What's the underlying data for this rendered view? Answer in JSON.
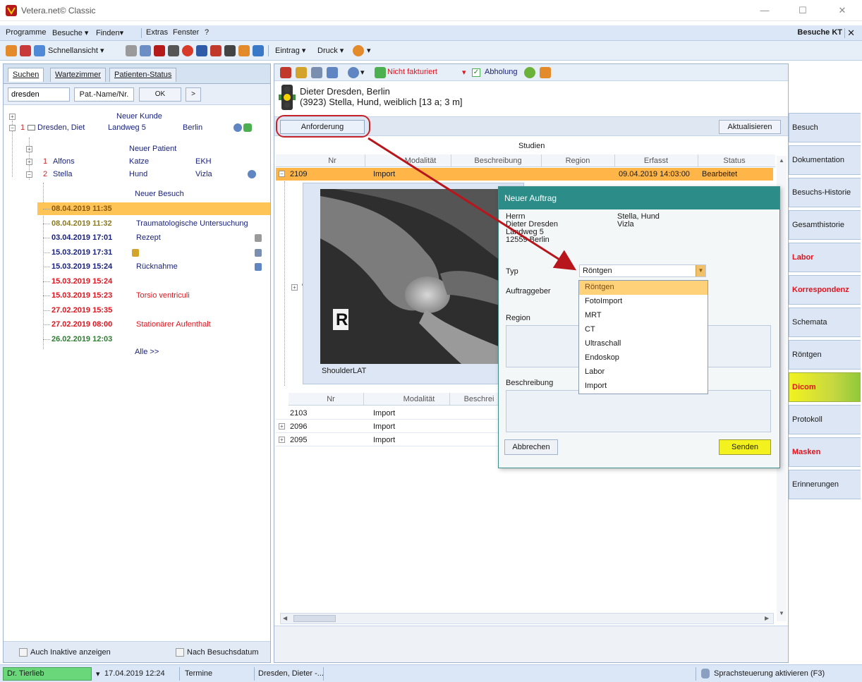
{
  "window": {
    "title": "Vetera.net© Classic"
  },
  "menu": {
    "items": [
      "Programme",
      "Besuche ▾",
      "Finden▾",
      "Extras",
      "Fenster",
      "?"
    ],
    "context_title": "Besuche KT",
    "close": "✕"
  },
  "toolbar1": {
    "schnellansicht": "Schnellansicht ▾",
    "eintrag": "Eintrag ▾",
    "druck": "Druck ▾"
  },
  "left": {
    "tabs": [
      "Suchen",
      "Wartezimmer",
      "Patienten-Status"
    ],
    "search_value": "dresden",
    "patname_label": "Pat.-Name/Nr.",
    "ok_label": "OK",
    "next_label": ">",
    "neuer_kunde": "Neuer Kunde",
    "customer": {
      "num": "1",
      "name": "Dresden, Diet",
      "street": "Landweg 5",
      "city": "Berlin"
    },
    "neuer_patient": "Neuer Patient",
    "patients": [
      {
        "num": "1",
        "name": "Alfons",
        "species": "Katze",
        "breed": "EKH"
      },
      {
        "num": "2",
        "name": "Stella",
        "species": "Hund",
        "breed": "Vizla"
      }
    ],
    "neuer_besuch": "Neuer Besuch",
    "visits": [
      {
        "date": "08.04.2019 11:35",
        "desc": "",
        "color": "#8a5a10"
      },
      {
        "date": "08.04.2019 11:32",
        "desc": "Traumatologische Untersuchung",
        "color": "#8a7a20"
      },
      {
        "date": "03.04.2019 17:01",
        "desc": "Rezept",
        "color": "#1a237e"
      },
      {
        "date": "15.03.2019 17:31",
        "desc": "",
        "color": "#1a237e"
      },
      {
        "date": "15.03.2019 15:24",
        "desc": "Rücknahme",
        "color": "#1a237e"
      },
      {
        "date": "15.03.2019 15:24",
        "desc": "",
        "color": "#e0141e"
      },
      {
        "date": "15.03.2019 15:23",
        "desc": "Torsio ventriculi",
        "color": "#e0141e"
      },
      {
        "date": "27.02.2019 15:35",
        "desc": "",
        "color": "#e0141e"
      },
      {
        "date": "27.02.2019 08:00",
        "desc": "Stationärer Aufenthalt",
        "color": "#e0141e"
      },
      {
        "date": "26.02.2019 12:03",
        "desc": "",
        "color": "#2e7d32"
      }
    ],
    "alle": "Alle >>",
    "auch_inaktive": "Auch Inaktive anzeigen",
    "nach_besuchsdatum": "Nach Besuchsdatum"
  },
  "toolbar2": {
    "nicht_fakturiert": "Nicht fakturiert",
    "abholung": "Abholung"
  },
  "patient": {
    "line1": "Dieter Dresden, Berlin",
    "line2": "(3923) Stella, Hund, weiblich [13 a; 3 m]"
  },
  "studies": {
    "anforderung": "Anforderung",
    "aktualisieren": "Aktualisieren",
    "title": "Studien",
    "columns": [
      "Nr",
      "Modalität",
      "Beschreibung",
      "Region",
      "Erfasst",
      "Status"
    ],
    "selected": {
      "nr": "2109",
      "modalitaet": "Import",
      "erfasst": "09.04.2019 14:03:00",
      "status": "Bearbeitet"
    },
    "image_label": "ShoulderLAT",
    "xray_marker": "R",
    "sub_columns": [
      "Nr",
      "Modalität",
      "Beschrei"
    ],
    "rows": [
      {
        "nr": "2103",
        "modalitaet": "Import"
      },
      {
        "nr": "2096",
        "modalitaet": "Import"
      },
      {
        "nr": "2095",
        "modalitaet": "Import"
      }
    ]
  },
  "dialog": {
    "title": "Neuer Auftrag",
    "owner": [
      "Herrn",
      "Dieter Dresden",
      "Landweg 5",
      "12559 Berlin"
    ],
    "animal": [
      "Stella, Hund",
      "Vizla"
    ],
    "typ_label": "Typ",
    "typ_value": "Röntgen",
    "auftraggeber_label": "Auftraggeber",
    "region_label": "Region",
    "beschreibung_label": "Beschreibung",
    "options": [
      "Röntgen",
      "FotoImport",
      "MRT",
      "CT",
      "Ultraschall",
      "Endoskop",
      "Labor",
      "Import"
    ],
    "abbrechen": "Abbrechen",
    "senden": "Senden"
  },
  "rightnav": {
    "tabs": [
      "Besuch",
      "Dokumentation",
      "Besuchs-Historie",
      "Gesamthistorie",
      "Labor",
      "Korrespondenz",
      "Schemata",
      "Röntgen",
      "Dicom",
      "Protokoll",
      "Masken",
      "Erinnerungen"
    ]
  },
  "status": {
    "user": "Dr. Tierlieb",
    "datetime": "17.04.2019  12:24",
    "termine": "Termine",
    "patient": "Dresden, Dieter -...",
    "voice": "Sprachsteuerung aktivieren (F3)"
  },
  "colors": {
    "accent_orange": "#ffb547",
    "dialog_teal": "#2c8c88",
    "senden_yellow": "#f3f21f",
    "user_green": "#6ad77a",
    "arrow_red": "#b7161c"
  }
}
